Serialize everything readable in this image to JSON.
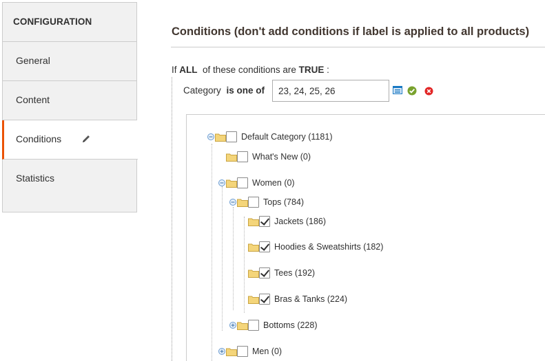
{
  "sidebar": {
    "heading": "CONFIGURATION",
    "items": [
      {
        "label": "General"
      },
      {
        "label": "Content"
      },
      {
        "label": "Conditions"
      },
      {
        "label": "Statistics"
      }
    ]
  },
  "main": {
    "title": "Conditions (don't add conditions if label is applied to all products)",
    "aggregator": {
      "prefix": "If",
      "value": "ALL",
      "middle": "of these conditions are",
      "result": "TRUE",
      "suffix": ":"
    },
    "condition": {
      "attribute": "Category",
      "operator": "is one of",
      "value": "23, 24, 25, 26"
    },
    "tree": [
      {
        "label": "Default Category (1181)",
        "checked": false,
        "expander": "minus"
      },
      {
        "label": "What's New (0)",
        "checked": false,
        "expander": "none"
      },
      {
        "label": "Women (0)",
        "checked": false,
        "expander": "minus"
      },
      {
        "label": "Tops (784)",
        "checked": false,
        "expander": "minus"
      },
      {
        "label": "Jackets (186)",
        "checked": true,
        "expander": "none"
      },
      {
        "label": "Hoodies & Sweatshirts (182)",
        "checked": true,
        "expander": "none"
      },
      {
        "label": "Tees (192)",
        "checked": true,
        "expander": "none"
      },
      {
        "label": "Bras & Tanks (224)",
        "checked": true,
        "expander": "none"
      },
      {
        "label": "Bottoms (228)",
        "checked": false,
        "expander": "plus"
      },
      {
        "label": "Men (0)",
        "checked": false,
        "expander": "plus"
      }
    ]
  },
  "colors": {
    "accent": "#eb5202",
    "apply": "#79a22e",
    "remove": "#e22626",
    "chooser": "#1979c3"
  },
  "icons": {
    "edit": "pencil-icon",
    "chooser": "list-icon",
    "apply": "check-circle-icon",
    "remove": "close-circle-icon",
    "folder": "folder-icon"
  }
}
